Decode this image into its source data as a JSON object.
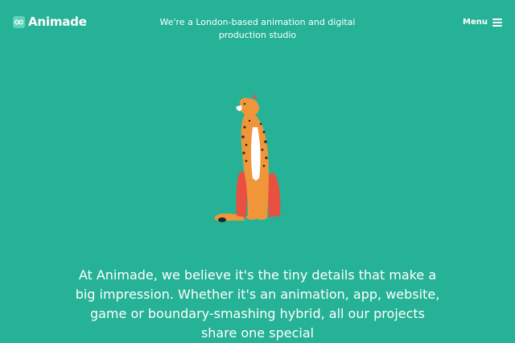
{
  "header": {
    "logo_text": "Animade",
    "tagline": "We're a London-based animation and digital production studio",
    "menu_label": "Menu"
  },
  "icons": {
    "logo_mark": "infinity-icon",
    "menu": "hamburger-menu-icon",
    "hero": "cheetah-illustration"
  },
  "hero": {
    "intro": "At Animade, we believe it's the tiny details that make a big impression. Whether it's an animation, app, website, game or boundary-smashing hybrid, all our projects share one special"
  },
  "colors": {
    "background": "#26b296",
    "text": "#ffffff",
    "cheetah_body": "#f0963a",
    "cheetah_shadow": "#e9503f",
    "cheetah_belly": "#ffffff",
    "spots": "#1f2a2e"
  }
}
